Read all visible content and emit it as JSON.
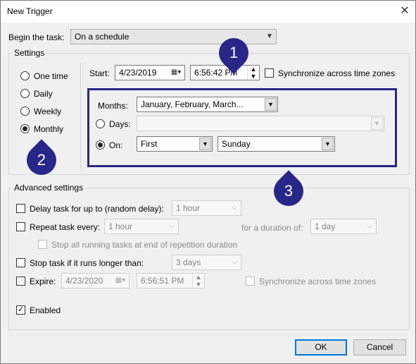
{
  "window": {
    "title": "New Trigger",
    "close_glyph": "✕"
  },
  "begin_task": {
    "label": "Begin the task:",
    "value": "On a schedule"
  },
  "settings": {
    "label": "Settings",
    "schedule_options": [
      {
        "label": "One time",
        "checked": false
      },
      {
        "label": "Daily",
        "checked": false
      },
      {
        "label": "Weekly",
        "checked": false
      },
      {
        "label": "Monthly",
        "checked": true
      }
    ],
    "start_label": "Start:",
    "start_date": "4/23/2019",
    "start_time": "6:56:42 PM",
    "sync_label": "Synchronize across time zones",
    "months_label": "Months:",
    "months_value": "January, February, March...",
    "days_label": "Days:",
    "days_value": "",
    "on_label": "On:",
    "on_week": "First",
    "on_day": "Sunday"
  },
  "advanced": {
    "label": "Advanced settings",
    "delay_label": "Delay task for up to (random delay):",
    "delay_value": "1 hour",
    "repeat_label": "Repeat task every:",
    "repeat_value": "1 hour",
    "duration_label": "for a duration of:",
    "duration_value": "1 day",
    "stop_running_label": "Stop all running tasks at end of repetition duration",
    "stop_longer_label": "Stop task if it runs longer than:",
    "stop_longer_value": "3 days",
    "expire_label": "Expire:",
    "expire_date": "4/23/2020",
    "expire_time": "6:56:51 PM",
    "expire_sync_label": "Synchronize across time zones",
    "enabled_label": "Enabled",
    "enabled_checked": true
  },
  "buttons": {
    "ok": "OK",
    "cancel": "Cancel"
  },
  "annotations": [
    "1",
    "2",
    "3"
  ],
  "colors": {
    "annotation": "#272787",
    "window_bg": "#f0f0f0"
  }
}
